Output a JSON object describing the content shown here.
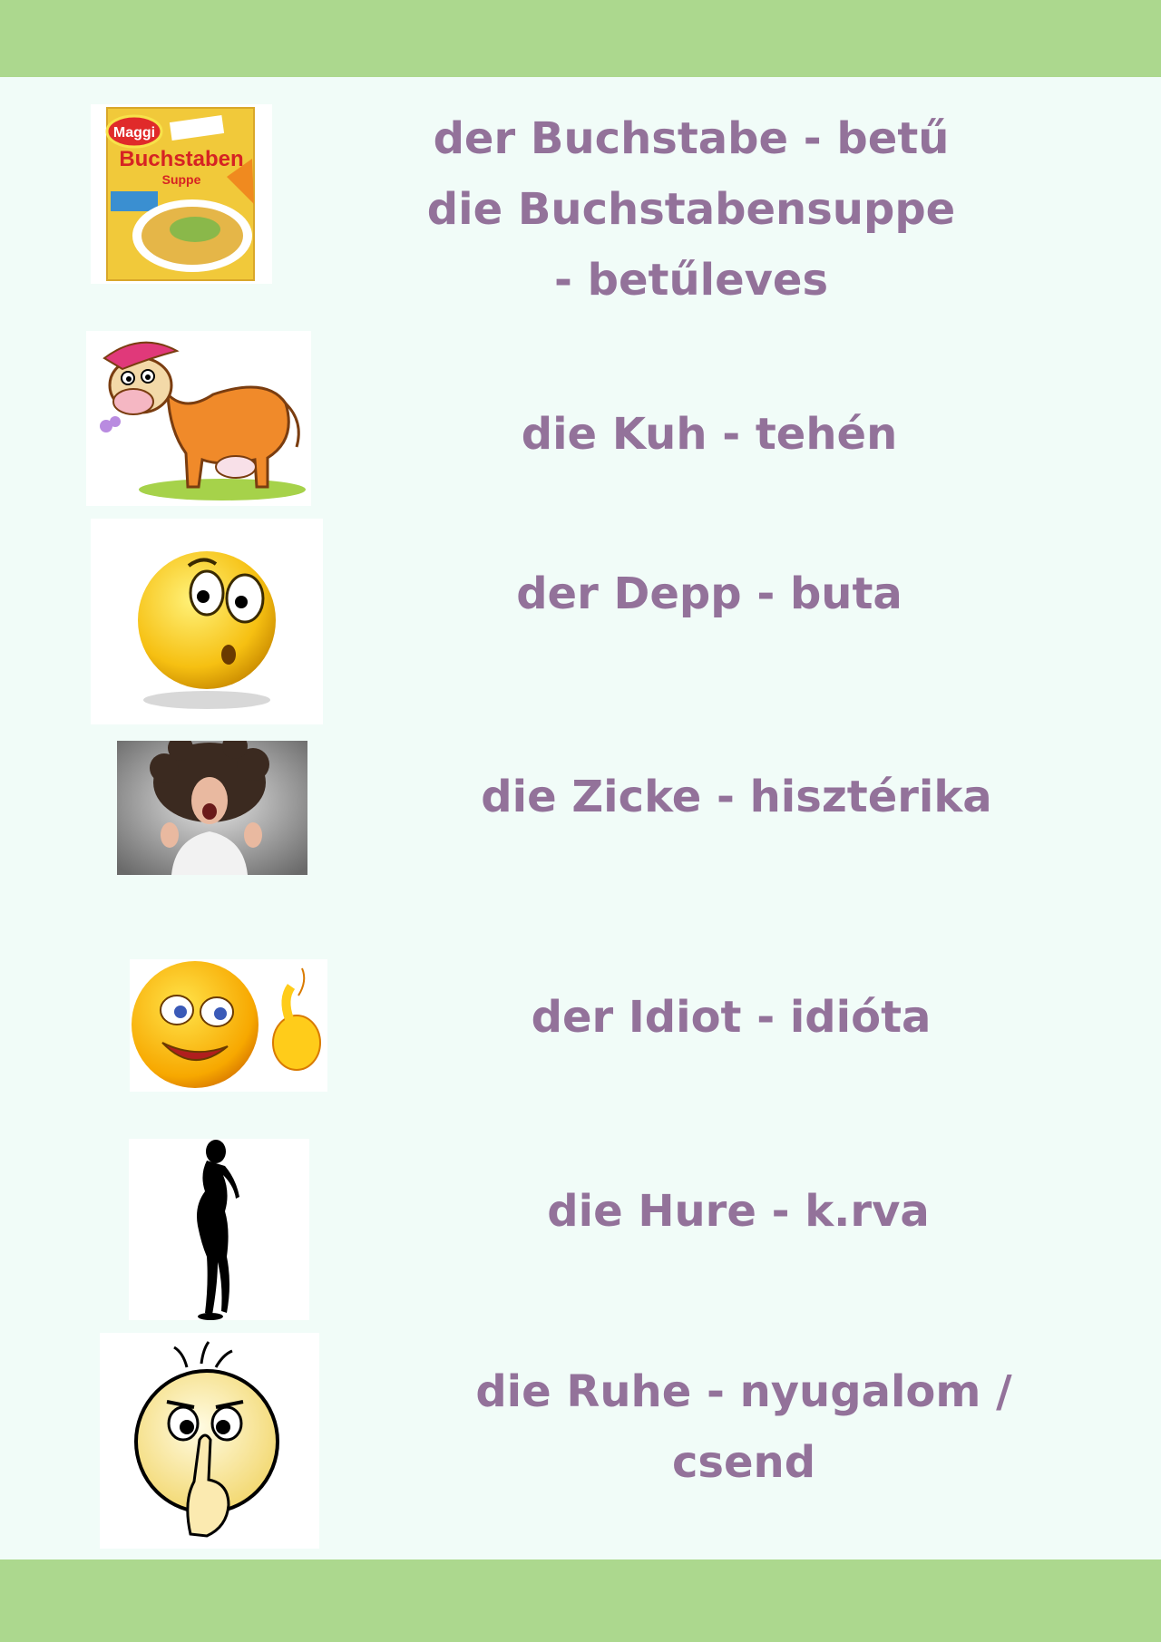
{
  "colors": {
    "band": "#acd88e",
    "background": "#f1fcf8",
    "text": "#93729a"
  },
  "entries": [
    {
      "image": "soup-packet-picture",
      "package_brand": "Maggi",
      "package_title": "Buchstaben",
      "package_subtitle": "Suppe",
      "lines": [
        "der Buchstabe  - betű",
        "die Buchstabensuppe",
        "- betűleves"
      ]
    },
    {
      "image": "cow-picture",
      "lines": [
        "die Kuh - tehén"
      ]
    },
    {
      "image": "confused-smiley-picture",
      "lines": [
        "der Depp - buta"
      ]
    },
    {
      "image": "screaming-woman-picture",
      "lines": [
        "die Zicke - hisztérika"
      ]
    },
    {
      "image": "idiot-smiley-picture",
      "lines": [
        "der Idiot - idióta"
      ]
    },
    {
      "image": "woman-silhouette-picture",
      "lines": [
        "die Hure - k.rva"
      ]
    },
    {
      "image": "shush-smiley-picture",
      "lines": [
        "die Ruhe - nyugalom /",
        "csend"
      ]
    }
  ]
}
